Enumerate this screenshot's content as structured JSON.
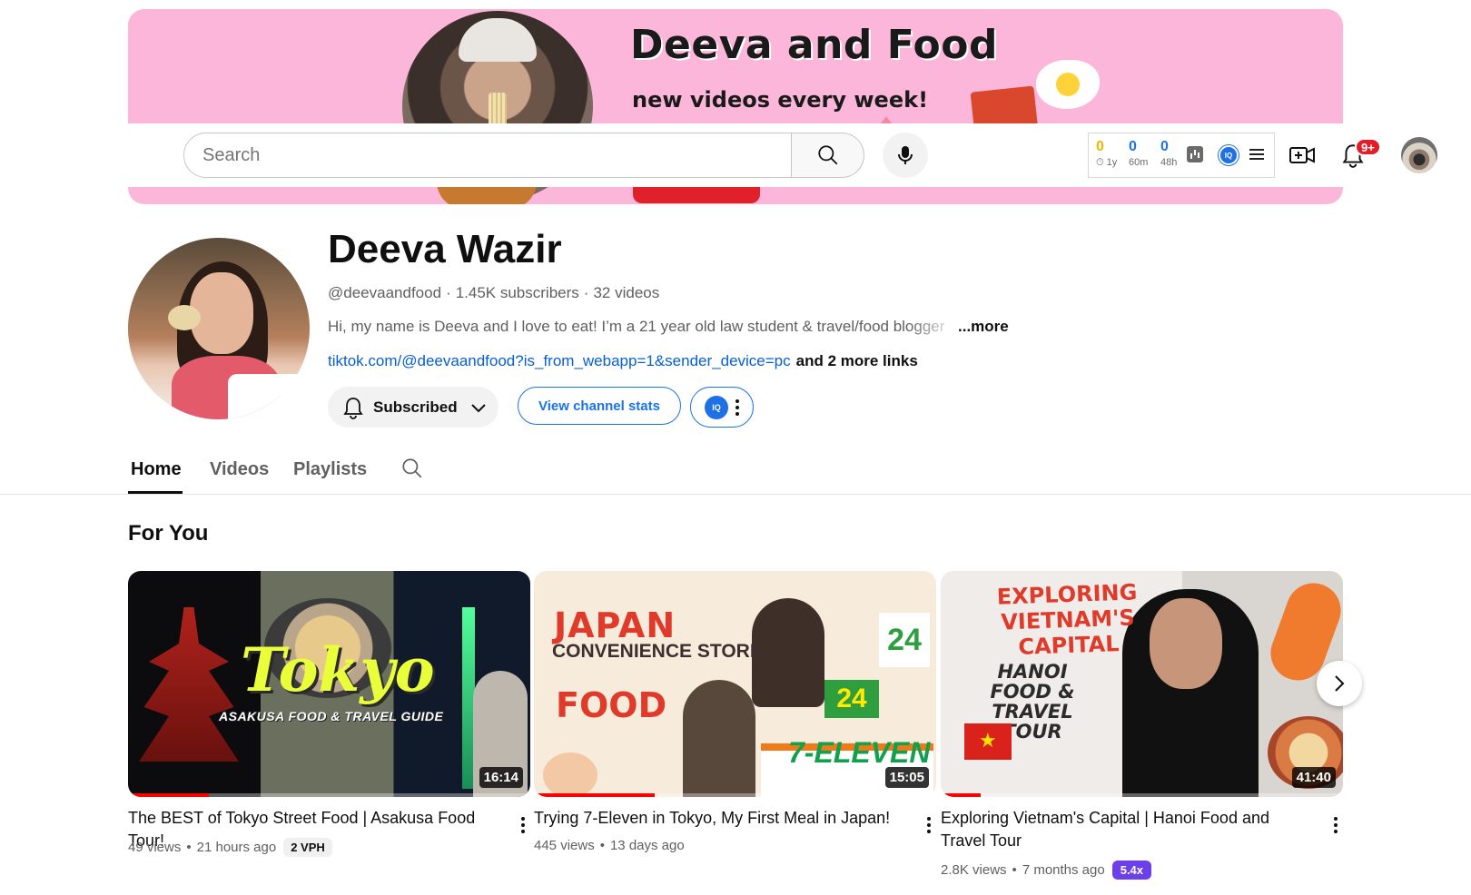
{
  "banner": {
    "title": "Deeva and Food",
    "subtitle": "new videos every week!"
  },
  "search": {
    "placeholder": "Search"
  },
  "stats_widget": {
    "items": [
      {
        "value": "0",
        "label": "1y",
        "color": "#f5b400"
      },
      {
        "value": "0",
        "label": "60m",
        "color": "#1a73e8"
      },
      {
        "value": "0",
        "label": "48h",
        "color": "#1a73e8"
      }
    ],
    "logo_text": "IQ"
  },
  "notifications": {
    "badge": "9+"
  },
  "channel": {
    "name": "Deeva Wazir",
    "handle": "@deevaandfood",
    "subscribers": "1.45K subscribers",
    "videos": "32 videos",
    "description": "Hi, my name is Deeva and I love to eat! I’m a 21 year old law student & travel/food blogger",
    "more_label": "...more",
    "link": "tiktok.com/@deevaandfood?is_from_webapp=1&sender_device=pc",
    "more_links": "and 2 more links",
    "subscribed_label": "Subscribed",
    "stats_button": "View channel stats",
    "iq_logo": "IQ"
  },
  "tabs": [
    {
      "label": "Home",
      "active": true
    },
    {
      "label": "Videos",
      "active": false
    },
    {
      "label": "Playlists",
      "active": false
    }
  ],
  "shelf": {
    "title": "For You",
    "videos": [
      {
        "title": "The BEST of Tokyo Street Food | Asakusa Food Tour!",
        "views": "49 views",
        "age": "21 hours ago",
        "badge": "2 VPH",
        "duration": "16:14",
        "thumb_text": "Tokyo",
        "thumb_sub": "ASAKUSA FOOD & TRAVEL GUIDE",
        "progress": 0.2
      },
      {
        "title": "Trying 7-Eleven in Tokyo, My First Meal in Japan!",
        "views": "445 views",
        "age": "13 days ago",
        "duration": "15:05",
        "thumb_japan": "JAPAN",
        "thumb_conv": "CONVENIENCE STORE",
        "thumb_food": "FOOD",
        "thumb_seven": "7-ELEVEN",
        "thumb_24": "24",
        "progress": 0.3
      },
      {
        "title": "Exploring Vietnam's Capital | Hanoi Food and Travel Tour",
        "views": "2.8K views",
        "age": "7 months ago",
        "badge": "5.4x",
        "duration": "41:40",
        "thumb_explore": "EXPLORING VIETNAM'S CAPITAL",
        "thumb_hanoi": "HANOI FOOD & TRAVEL TOUR",
        "progress": 0.1
      }
    ]
  }
}
